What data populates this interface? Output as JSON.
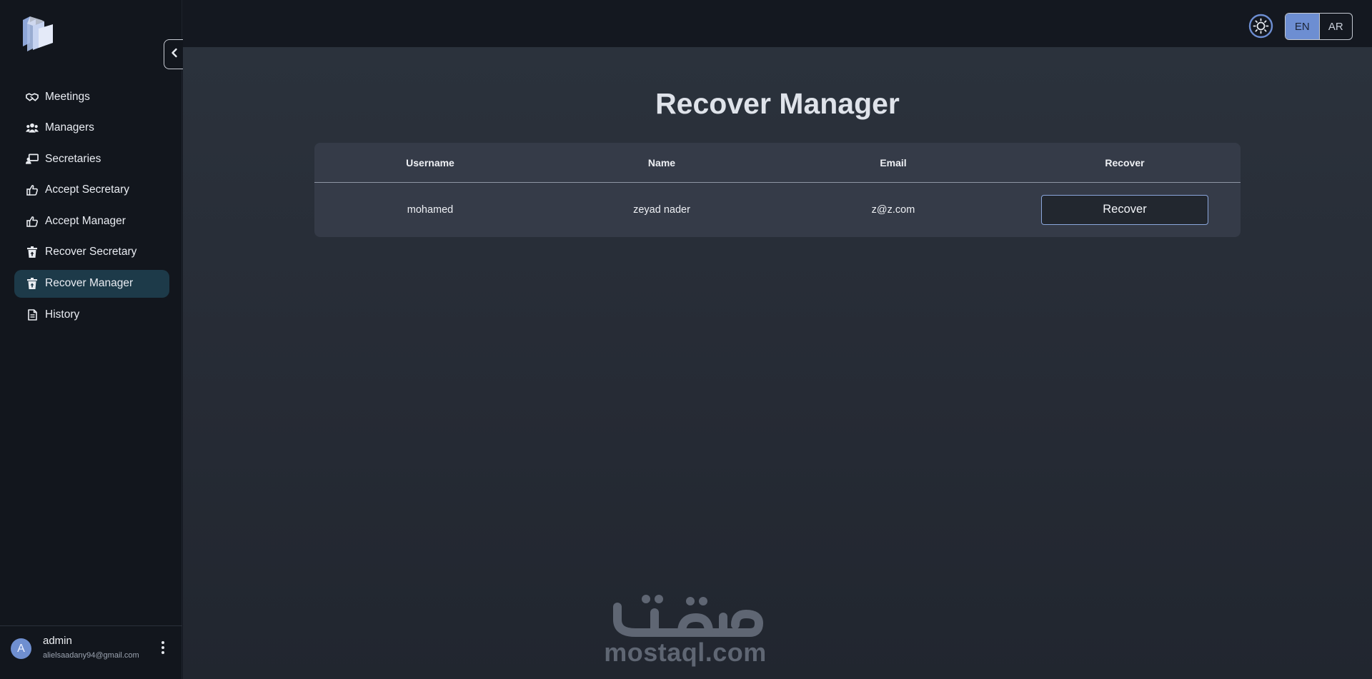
{
  "sidebar": {
    "items": [
      {
        "label": "Meetings",
        "icon": "handshake-icon",
        "active": false
      },
      {
        "label": "Managers",
        "icon": "users-icon",
        "active": false
      },
      {
        "label": "Secretaries",
        "icon": "chalkboard-user-icon",
        "active": false
      },
      {
        "label": "Accept Secretary",
        "icon": "thumbs-up-icon",
        "active": false
      },
      {
        "label": "Accept Manager",
        "icon": "thumbs-up-icon",
        "active": false
      },
      {
        "label": "Recover Secretary",
        "icon": "trash-restore-icon",
        "active": false
      },
      {
        "label": "Recover Manager",
        "icon": "trash-restore-icon",
        "active": true
      },
      {
        "label": "History",
        "icon": "file-icon",
        "active": false
      }
    ]
  },
  "user": {
    "avatar_letter": "A",
    "name": "admin",
    "email": "alielsaadany94@gmail.com"
  },
  "topbar": {
    "theme_icon": "sun-icon",
    "languages": [
      {
        "label": "EN",
        "active": true
      },
      {
        "label": "AR",
        "active": false
      }
    ]
  },
  "main": {
    "title": "Recover Manager",
    "table": {
      "columns": [
        "Username",
        "Name",
        "Email",
        "Recover"
      ],
      "rows": [
        {
          "username": "mohamed",
          "name": "zeyad nader",
          "email": "z@z.com",
          "action_label": "Recover"
        }
      ]
    }
  },
  "watermark": {
    "arabic": "مستقل",
    "latin": "mostaql.com"
  },
  "colors": {
    "accent": "#6d8ed2",
    "active_nav": "#1d3a49",
    "sidebar_bg": "#12161d",
    "card_bg": "#353b48"
  }
}
